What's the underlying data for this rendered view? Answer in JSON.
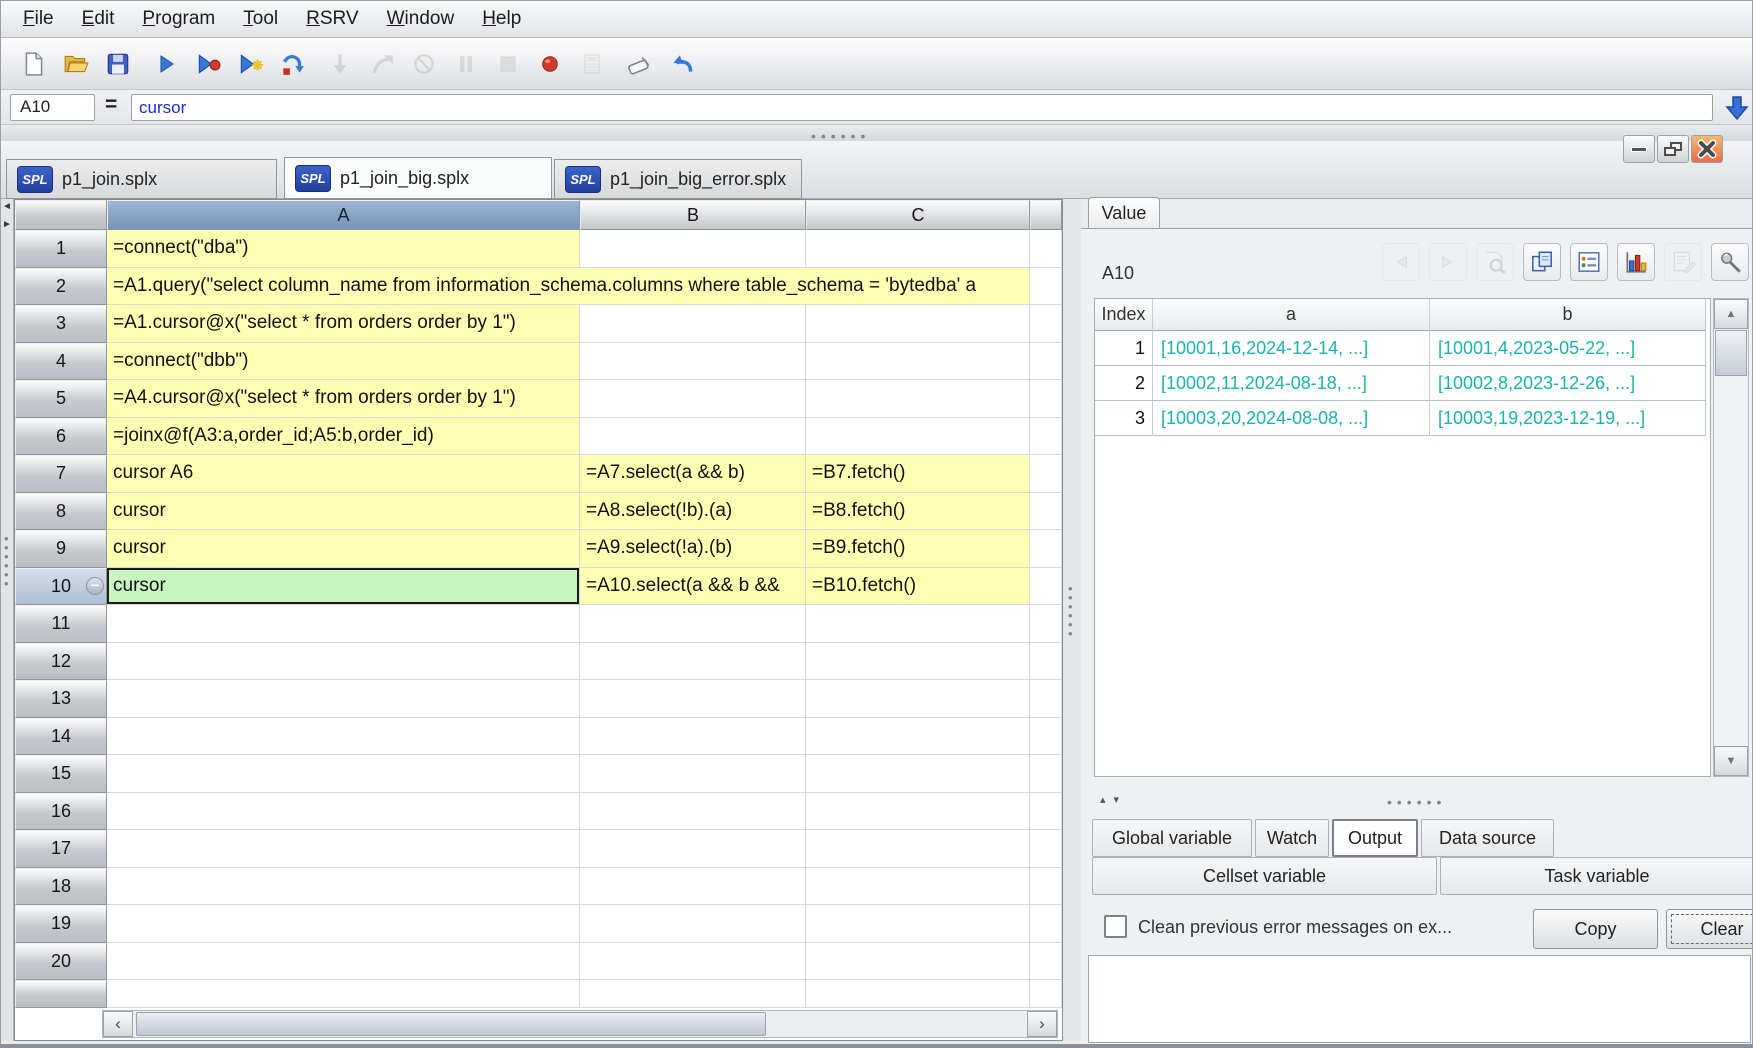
{
  "menu_bar": {
    "items": [
      {
        "label": "File",
        "mnemonic": "F"
      },
      {
        "label": "Edit",
        "mnemonic": "E"
      },
      {
        "label": "Program",
        "mnemonic": "P"
      },
      {
        "label": "Tool",
        "mnemonic": "T"
      },
      {
        "label": "RSRV",
        "mnemonic": "R"
      },
      {
        "label": "Window",
        "mnemonic": "W"
      },
      {
        "label": "Help",
        "mnemonic": "H"
      }
    ]
  },
  "toolbar": {
    "icons": [
      {
        "name": "new-file",
        "enabled": true
      },
      {
        "name": "open-file",
        "enabled": true
      },
      {
        "name": "save-file",
        "enabled": true
      },
      {
        "name": "execute",
        "enabled": true
      },
      {
        "name": "execute-debug",
        "enabled": true
      },
      {
        "name": "step-execute",
        "enabled": true
      },
      {
        "name": "step-over",
        "enabled": true
      },
      {
        "name": "step-return",
        "enabled": false
      },
      {
        "name": "step-out",
        "enabled": false
      },
      {
        "name": "interrupt",
        "enabled": false
      },
      {
        "name": "pause",
        "enabled": false
      },
      {
        "name": "stop",
        "enabled": false
      },
      {
        "name": "breakpoint",
        "enabled": true
      },
      {
        "name": "calculate-area",
        "enabled": false
      },
      {
        "name": "clear-cell",
        "enabled": true
      },
      {
        "name": "undo",
        "enabled": true
      }
    ]
  },
  "formula_bar": {
    "cell_ref": "A10",
    "operator": "=",
    "expression": "cursor"
  },
  "file_tabs": [
    {
      "label": "p1_join.splx",
      "badge": "SPL",
      "active": false
    },
    {
      "label": "p1_join_big.splx",
      "badge": "SPL",
      "active": true
    },
    {
      "label": "p1_join_big_error.splx",
      "badge": "SPL",
      "active": false
    }
  ],
  "window_controls": [
    {
      "name": "minimize"
    },
    {
      "name": "restore"
    },
    {
      "name": "close"
    }
  ],
  "sheet": {
    "column_headers": [
      "A",
      "B",
      "C"
    ],
    "row_count": 20,
    "selected_cell": "A10",
    "rows": [
      {
        "n": 1,
        "a": "=connect(\"dba\")"
      },
      {
        "n": 2,
        "a": "=A1.query(\"select column_name from information_schema.columns where table_schema = 'bytedba' a",
        "overflow": true
      },
      {
        "n": 3,
        "a": "=A1.cursor@x(\"select * from orders order by 1\")"
      },
      {
        "n": 4,
        "a": "=connect(\"dbb\")"
      },
      {
        "n": 5,
        "a": "=A4.cursor@x(\"select * from orders order by 1\")"
      },
      {
        "n": 6,
        "a": "=joinx@f(A3:a,order_id;A5:b,order_id)"
      },
      {
        "n": 7,
        "a": "cursor A6",
        "b": "=A7.select(a && b)",
        "c": "=B7.fetch()"
      },
      {
        "n": 8,
        "a": "cursor",
        "b": "=A8.select(!b).(a)",
        "c": "=B8.fetch()"
      },
      {
        "n": 9,
        "a": "cursor",
        "b": "=A9.select(!a).(b)",
        "c": "=B9.fetch()"
      },
      {
        "n": 10,
        "a": "cursor",
        "b": "=A10.select(a && b &&",
        "c": "=B10.fetch()",
        "selected": true,
        "marker": "minus-circle"
      }
    ]
  },
  "value_panel": {
    "tab_label": "Value",
    "cell_ref": "A10",
    "toolbar": [
      {
        "name": "prev",
        "enabled": false
      },
      {
        "name": "next",
        "enabled": false
      },
      {
        "name": "zoom",
        "enabled": false
      },
      {
        "name": "copy-data",
        "enabled": true
      },
      {
        "name": "display-format",
        "enabled": true
      },
      {
        "name": "draw-chart",
        "enabled": true
      },
      {
        "name": "export",
        "enabled": false
      },
      {
        "name": "pin",
        "enabled": true
      }
    ],
    "table": {
      "headers": [
        "Index",
        "a",
        "b"
      ],
      "rows": [
        {
          "index": "1",
          "a": "[10001,16,2024-12-14, ...]",
          "b": "[10001,4,2023-05-22, ...]"
        },
        {
          "index": "2",
          "a": "[10002,11,2024-08-18, ...]",
          "b": "[10002,8,2023-12-26, ...]"
        },
        {
          "index": "3",
          "a": "[10003,20,2024-08-08, ...]",
          "b": "[10003,19,2023-12-19, ...]"
        }
      ]
    }
  },
  "bottom_panel": {
    "tabs_row1": [
      {
        "label": "Global variable",
        "active": false
      },
      {
        "label": "Watch",
        "active": false
      },
      {
        "label": "Output",
        "active": true
      },
      {
        "label": "Data source",
        "active": false
      }
    ],
    "tabs_row2": [
      {
        "label": "Cellset variable",
        "active": false
      },
      {
        "label": "Task variable",
        "active": false
      }
    ],
    "output_controls": {
      "checkbox_label": "Clean previous error messages on ex...",
      "checkbox_checked": false,
      "copy_label": "Copy",
      "clear_label": "Clear"
    }
  },
  "colors": {
    "cell_yellow": "#ffffb4",
    "cell_selected_green": "#c9f5c3",
    "column_header_blue": "#7d9ec3",
    "value_text_teal": "#19b3ac",
    "spl_badge_blue": "#2b50b5",
    "formula_text_blue": "#2626cc",
    "close_button_orange": "#ec6a4c"
  }
}
